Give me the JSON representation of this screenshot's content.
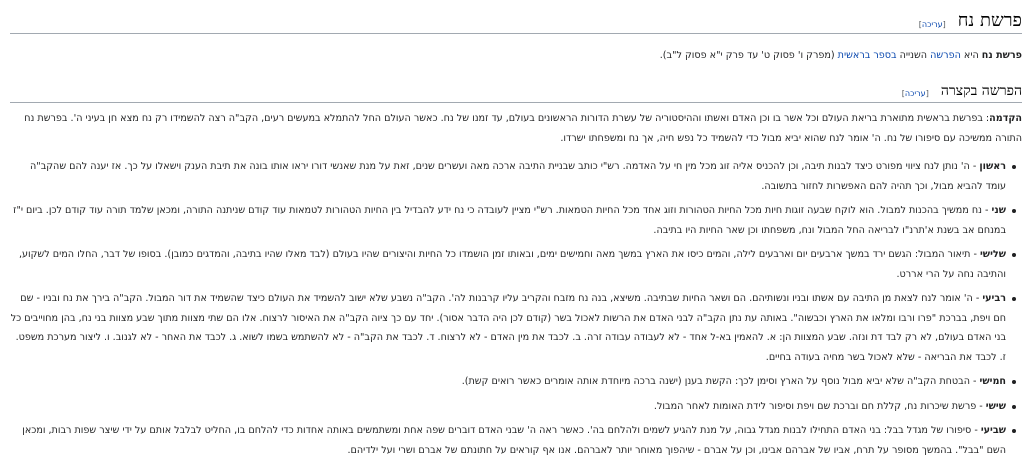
{
  "title": "פרשת נח",
  "edit_label": "עריכה",
  "intro": {
    "name": "פרשת נח",
    "t1": " היא ",
    "link1": "הפרשה",
    "t2": " השנייה ",
    "link2": "בספר בראשית",
    "t3": " (מפרק ו' פסוק ט' עד פרק י\"א פסוק ל\"ב)."
  },
  "summary_heading": "הפרשה בקצרה",
  "intro_para": {
    "label": "הקדמה",
    "text": ": בפרשת בראשית מתוארת בריאת העולם וכל אשר בו וכן האדם ואשתו וההיסטוריה של עשרת הדורות הראשונים בעולם, עד זמנו של נח. כאשר העולם החל להתמלא במעשים רעים, הקב\"ה רצה להשמידו רק נח מצא חן בעיני ה'. בפרשת נח התורה ממשיכה עם סיפורו של נח. ה' אומר לנח שהוא יביא מבול כדי להשמיד כל נפש חיה, אך נח ומשפחתו ישרדו."
  },
  "items": [
    {
      "label": "ראשון",
      "text": " - ה' נותן לנח ציווי מפורט כיצד לבנות תיבה, וכן להכניס אליה זוג מכל מין חי על האדמה. רש\"י כותב שבניית התיבה ארכה מאה ועשרים שנים, זאת על מנת שאנשי דורו יראו אותו בונה את תיבת הענק וישאלו על כך. אז יענה להם שהקב\"ה עומד להביא מבול, וכך תהיה להם האפשרות לחזור בתשובה."
    },
    {
      "label": "שני",
      "text": " - נח ממשיך בהכנות למבול. הוא לוקח שבעה זוגות חיות מכל החיות הטהורות וזוג אחד מכל החיות הטמאות. רש\"י מציין לעובדה כי נח ידע להבדיל בין החיות הטהורות לטמאות עוד קודם שניתנה התורה, ומכאן שלמד תורה עוד קודם לכן. ביום י\"ז במנחם אב בשנת א'תרנ\"ו לבריאה החל המבול ונח, משפחתו וכן שאר החיות היו בתיבה."
    },
    {
      "label": "שלישי",
      "text": " - תיאור המבול: הגשם ירד במשך ארבעים יום וארבעים לילה, והמים כיסו את הארץ במשך מאה וחמישים ימים, ובאותו זמן הושמדו כל החיות והיצורים שהיו בעולם (לבד מאלו שהיו בתיבה, והמדגים כמובן). בסופו של דבר, החלו המים לשקוע, והתיבה נחה על הרי אררט."
    },
    {
      "label": "רביעי",
      "text": " - ה' אומר לנח לצאת מן התיבה עם אשתו ובניו ונשותיהם. הם ושאר החיות שבתיבה. משיצא, בנה נח מזבח והקריב עליו קרבנות לה'. הקב\"ה נשבע שלא ישוב להשמיד את העולם כיצד שהשמיד את דור המבול. הקב\"ה בירך את נח ובניו - שם חם ויפת, בברכת \"פרו ורבו ומלאו את הארץ וכבשוה\". באותה עת נתן הקב\"ה לבני האדם את הרשות לאכול בשר (קודם לכן היה הדבר אסור). יחד עם כך ציוה הקב\"ה את האיסור לרצוח. אלו הם שתי מצוות מתוך שבע מצוות בני נח, בהן מחוייבים כל בני האדם בעולם, לא רק לבד דת ונזה. שבע המצוות הן: א. להאמין בא-ל אחד - לא לעבודה עבודה זרה. ב. לכבד את מין האדם - לא לרצוח. ד. לכבד את הקב\"ה - לא להשתמש בשמו לשוא. ג. לכבד את האחר - לא לגנוב. ו. ליצור מערכת משפט. ז. לכבד את הבריאה - שלא לאכול בשר מחיה בעודה בחיים."
    },
    {
      "label": "חמישי",
      "text": " - הבטחת הקב\"ה שלא יביא מבול נוסף על הארץ וסימן לכך: הקשת בענן (ישנה ברכה מיוחדת אותה אומרים כאשר רואים קשת)."
    },
    {
      "label": "שישי",
      "text": " - פרשת שיכרות נח, קללת חם וברכת שם ויפת וסיפור לידת האומות לאחר המבול."
    },
    {
      "label": "שביעי",
      "text": " - סיפורו של מגדל בבל: בני האדם התחילו לבנות מגדל גבוה, על מנת להגיע לשמים ולהלחם בה'. כאשר ראה ה' שבני האדם דוברים שפה אחת ומשתמשים באותה אחדות כדי להלחם בו, החליט לבלבל אותם על ידי שיצר שפות רבות, ומכאן השם \"בבל\". בהמשך מסופר על תרח, אביו של אברהם אבינו, וכן על אברם - שיהפוך מאוחר יותר לאברהם. אנו אף קוראים על חתונתם של אברם ושרי ועל ילדיהם."
    }
  ]
}
